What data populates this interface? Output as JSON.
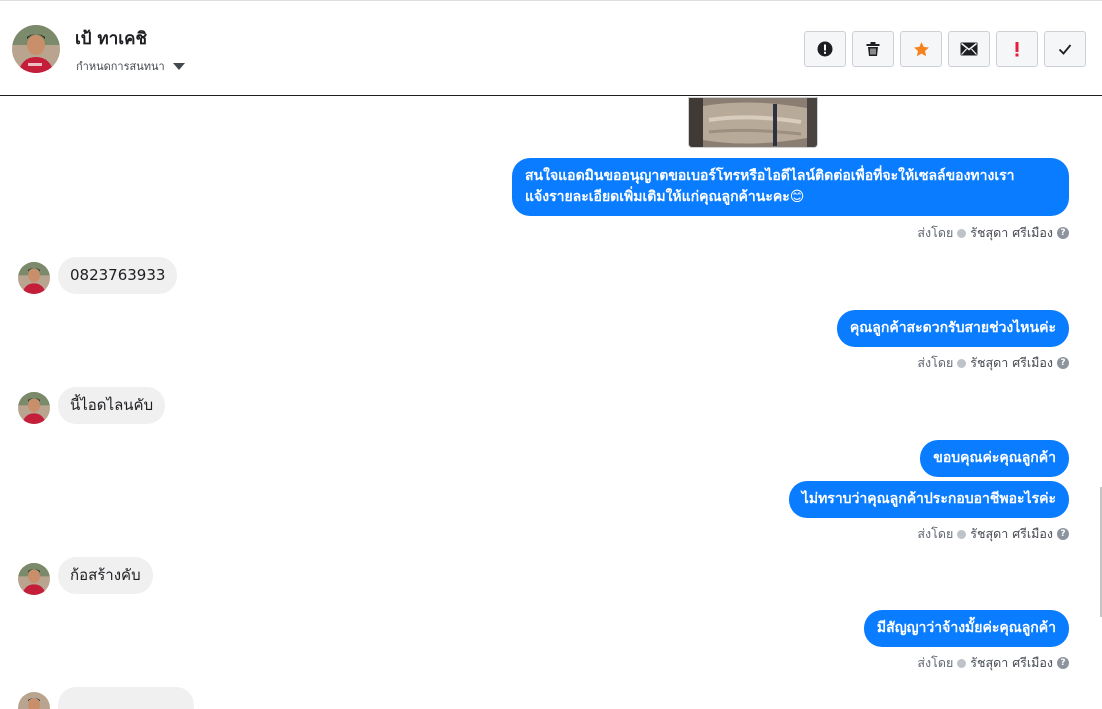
{
  "header": {
    "contact_name": "เป้ ทาเคชิ",
    "assign_label": "กำหนดการสนทนา"
  },
  "toolbar": {
    "buttons": [
      {
        "name": "alert-circle-icon"
      },
      {
        "name": "trash-icon"
      },
      {
        "name": "star-icon",
        "color": "#f5821f"
      },
      {
        "name": "envelope-icon"
      },
      {
        "name": "exclamation-icon",
        "color": "#e41e3f"
      },
      {
        "name": "checkmark-icon"
      }
    ]
  },
  "sent_by": {
    "prefix": "ส่งโดย",
    "agent": "รัชสุดา ศรีเมือง"
  },
  "messages": {
    "m1_line1": "สนใจแอดมินขออนุญาตขอเบอร์โทรหรือไอดีไลน์ติดต่อเพื่อที่จะให้เซลล์ของทางเรา",
    "m1_line2": "แจ้งรายละเอียดเพิ่มเติมให้แก่คุณลูกค้านะคะ😊",
    "m2": "0823763933",
    "m3": "คุณลูกค้าสะดวกรับสายช่วงไหนค่ะ",
    "m4": "นี้ไอดไลนคับ",
    "m5": "ขอบคุณค่ะคุณลูกค้า",
    "m6": "ไม่ทราบว่าคุณลูกค้าประกอบอาชีพอะไรค่ะ",
    "m7": "ก้อสร้างคับ",
    "m8": "มีสัญญาว่าจ้างมั้ยค่ะคุณลูกค้า"
  },
  "colors": {
    "outgoing_bubble": "#0a7cff",
    "incoming_bubble": "#f0f0f0"
  }
}
